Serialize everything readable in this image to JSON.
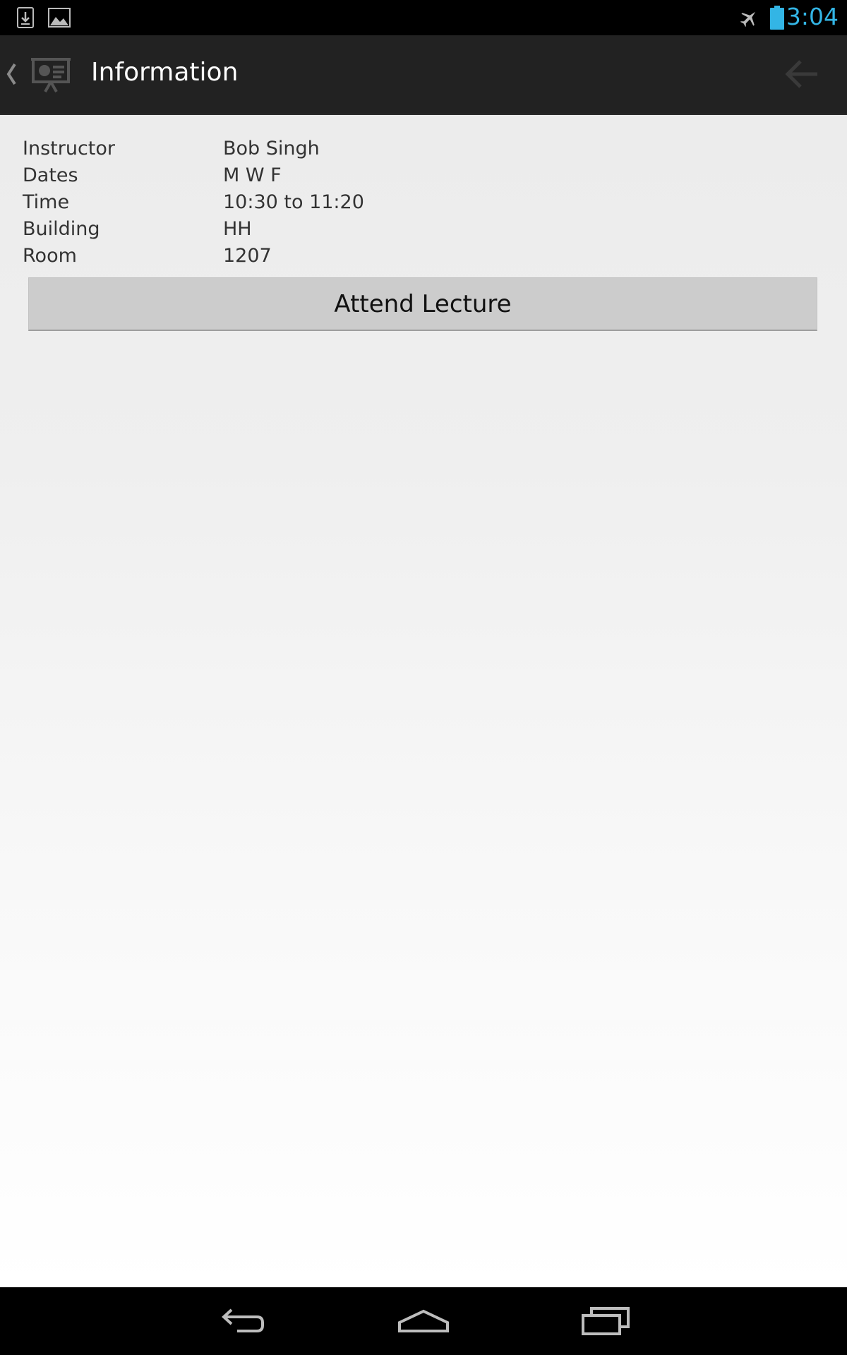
{
  "status_bar": {
    "time": "3:04",
    "time_color": "#33b5e5",
    "left_icons": [
      "download-notification-icon",
      "image-notification-icon"
    ],
    "right_icons": [
      "airplane-mode-icon",
      "battery-icon"
    ]
  },
  "action_bar": {
    "title": "Information",
    "icons": [
      "up-caret-icon",
      "presentation-app-icon",
      "back-arrow-icon"
    ]
  },
  "info": {
    "rows": [
      {
        "label": "Instructor",
        "value": "Bob Singh"
      },
      {
        "label": "Dates",
        "value": "M W F"
      },
      {
        "label": "Time",
        "value": "10:30 to 11:20"
      },
      {
        "label": "Building",
        "value": "HH"
      },
      {
        "label": "Room",
        "value": "1207"
      }
    ]
  },
  "attend_button": {
    "label": "Attend Lecture"
  },
  "nav_bar": {
    "buttons": [
      "back-nav-icon",
      "home-nav-icon",
      "recents-nav-icon"
    ]
  }
}
